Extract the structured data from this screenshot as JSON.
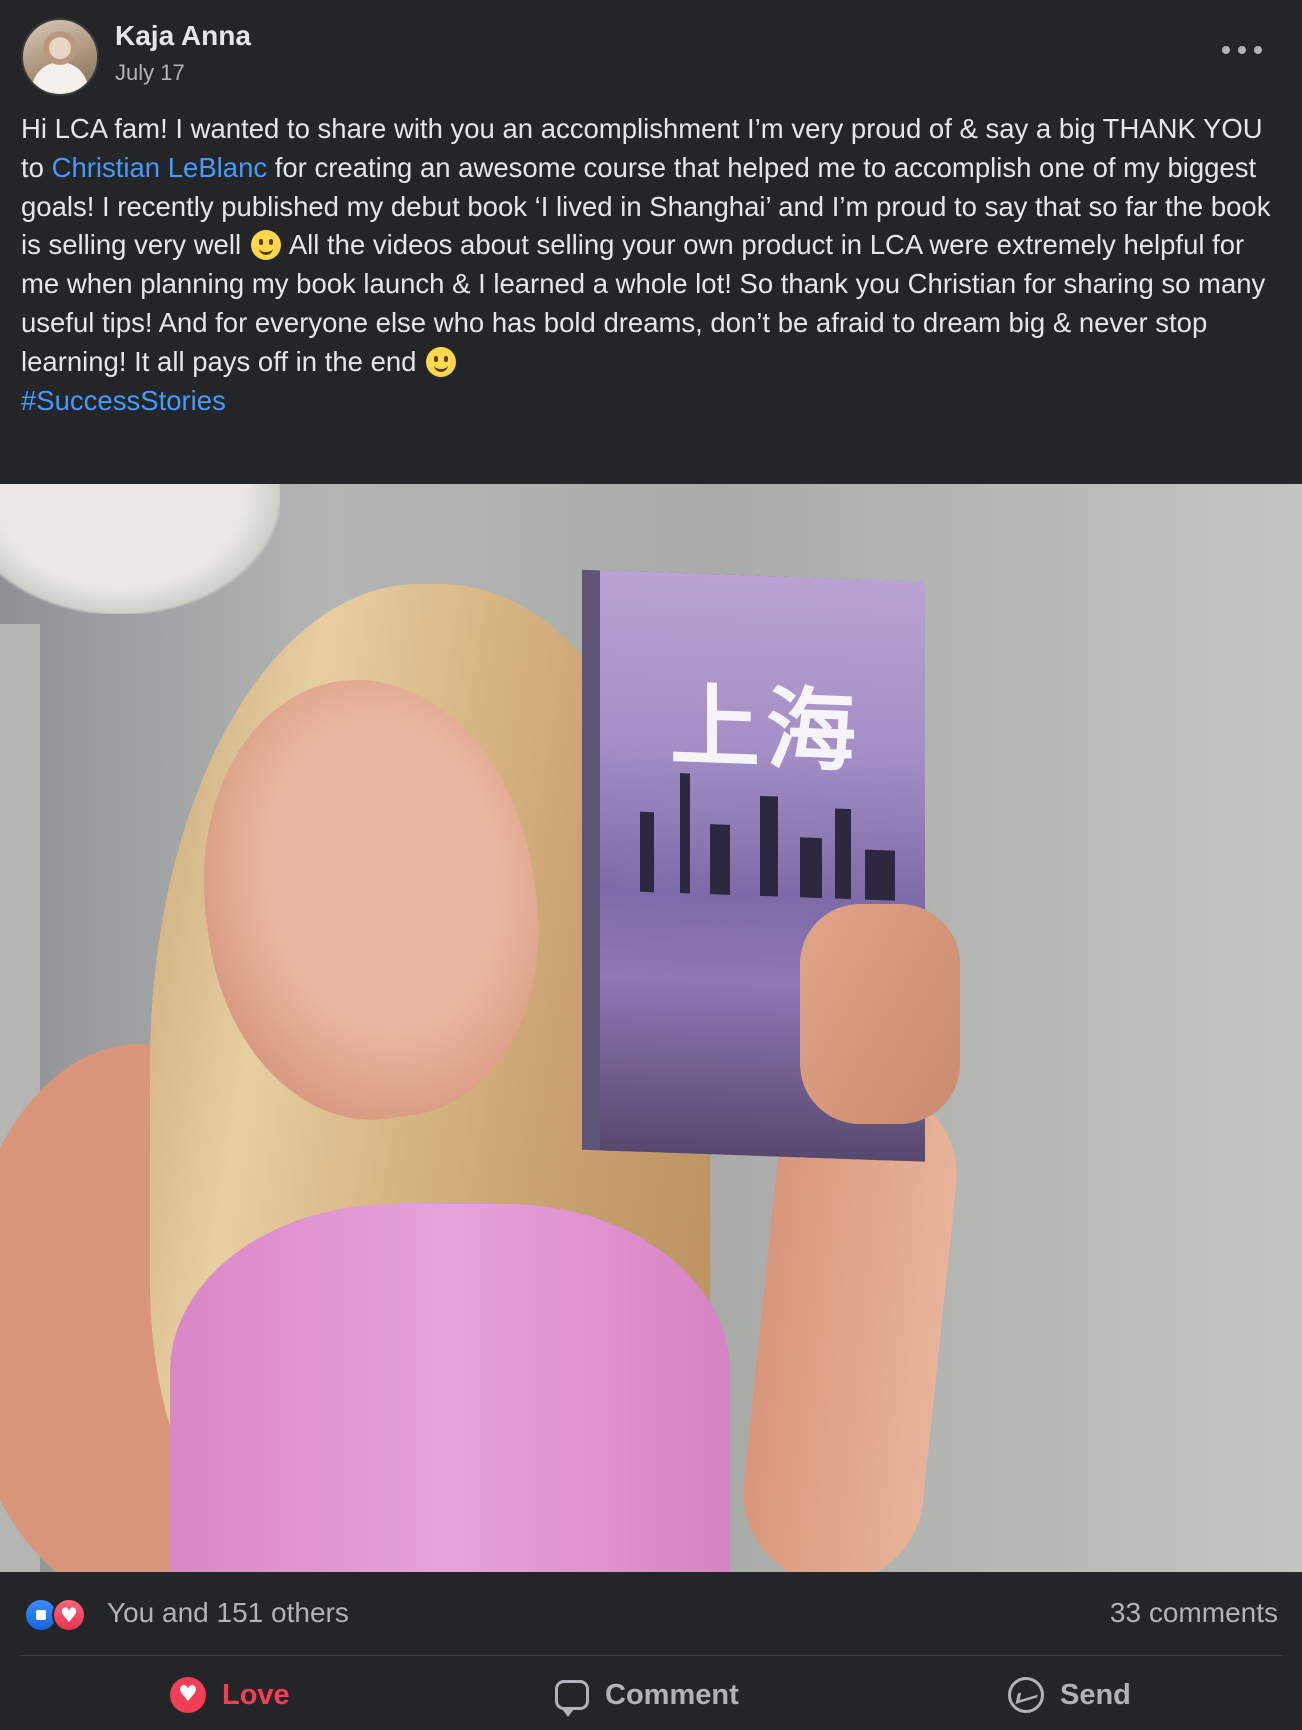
{
  "post": {
    "author": "Kaja Anna",
    "date": "July 17",
    "more_icon": "more-horizontal-icon",
    "text": {
      "part1": "Hi LCA fam! I wanted to share with you an accomplishment I’m very proud of & say a big THANK YOU to ",
      "mention": "Christian LeBlanc",
      "part2": " for creating an awesome course that helped me to accomplish one of my biggest goals! I recently published my debut book ‘I lived in Shanghai’ and I’m proud to say that so far the book is selling very well ",
      "part3": " All the videos about selling your own product in LCA were extremely helpful for me when planning my book launch & I learned a whole lot! So thank you Christian for sharing so many useful tips! And for everyone else who has bold dreams, don’t be afraid to dream big & never stop learning! It all pays off in the end ",
      "hashtag": "#SuccessStories"
    },
    "photo": {
      "book_cover_chars": "上海"
    },
    "colors": {
      "background": "#242526",
      "link": "#4599ff",
      "love": "#f33e58",
      "muted": "#b0b3b8"
    }
  },
  "footer": {
    "reactions_summary": "You and 151 others",
    "comments_count": "33 comments",
    "actions": {
      "love_label": "Love",
      "comment_label": "Comment",
      "send_label": "Send"
    }
  }
}
